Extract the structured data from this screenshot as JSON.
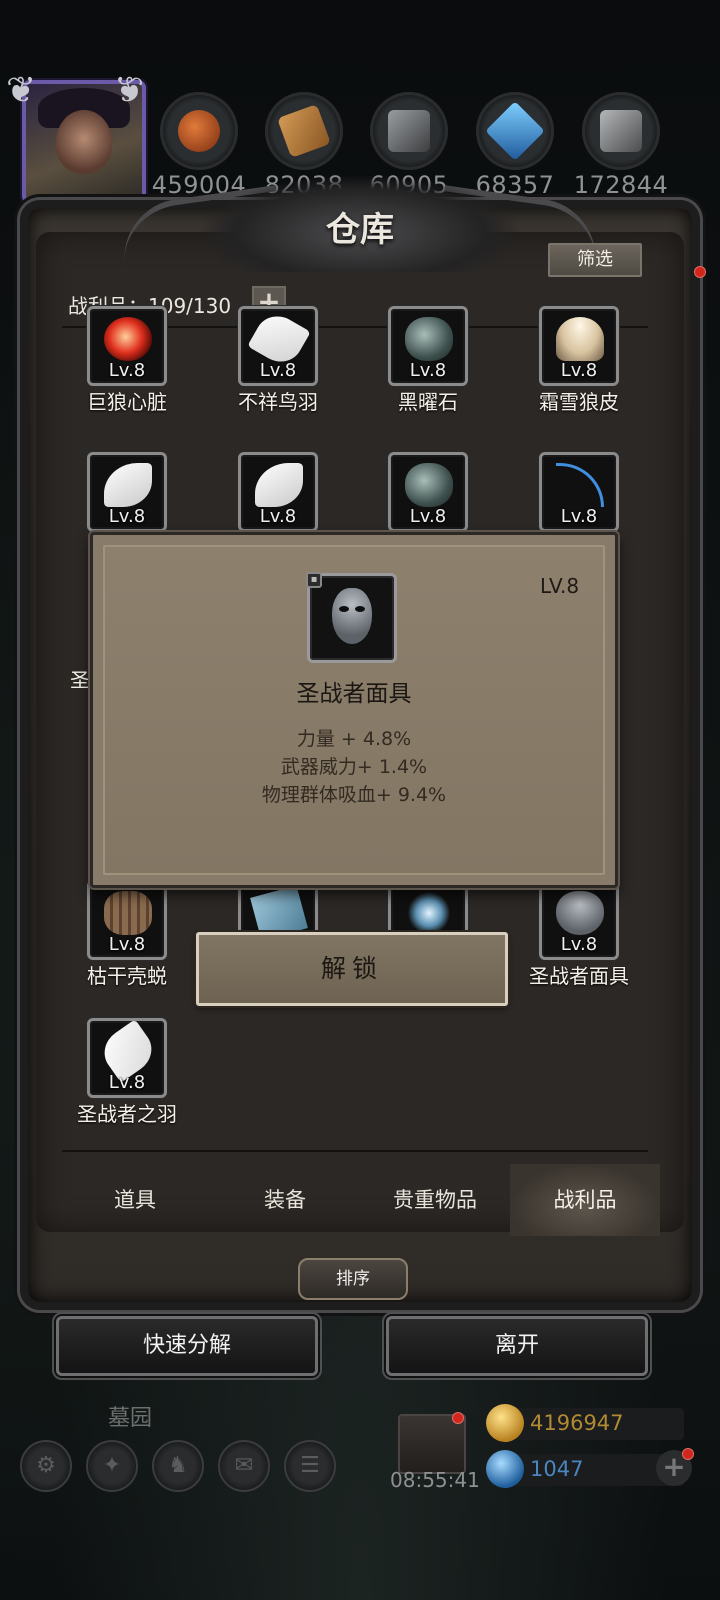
{
  "header": {
    "resources": [
      {
        "icon": "meat-icon",
        "value": "459004",
        "color": "#b35a2a"
      },
      {
        "icon": "wood-icon",
        "value": "82038",
        "color": "#b2793b"
      },
      {
        "icon": "iron-icon",
        "value": "60905",
        "color": "#6f7275"
      },
      {
        "icon": "crystal-icon",
        "value": "68357",
        "color": "#3c8fd0"
      },
      {
        "icon": "steel-icon",
        "value": "172844",
        "color": "#7a7c7e"
      }
    ]
  },
  "warehouse": {
    "title": "仓库",
    "filter_label": "筛选",
    "count_label": "战利品：109/130",
    "items_row1": [
      {
        "lv": "Lv.8",
        "name": "巨狼心脏",
        "icon": "heart-icon"
      },
      {
        "lv": "Lv.8",
        "name": "不祥鸟羽",
        "icon": "feather-icon"
      },
      {
        "lv": "Lv.8",
        "name": "黑曜石",
        "icon": "obsidian-icon"
      },
      {
        "lv": "Lv.8",
        "name": "霜雪狼皮",
        "icon": "wolf-pelt-icon"
      }
    ],
    "items_row2": [
      {
        "lv": "Lv.8",
        "icon": "wing-icon"
      },
      {
        "lv": "Lv.8",
        "icon": "wing-icon"
      },
      {
        "lv": "Lv.8",
        "icon": "obsidian-icon"
      },
      {
        "lv": "Lv.8",
        "icon": "scythe-icon"
      }
    ],
    "partial_left_name": "圣",
    "items_row4": [
      {
        "lv": "Lv.8",
        "name": "枯干壳蜕",
        "icon": "husk-icon"
      },
      {
        "lv": "",
        "name": "",
        "icon": "book-icon"
      },
      {
        "lv": "",
        "name": "",
        "icon": "emblem-icon"
      },
      {
        "lv": "Lv.8",
        "name": "圣战者面具",
        "icon": "mask-icon"
      }
    ],
    "items_row5": [
      {
        "lv": "Lv.8",
        "name": "圣战者之羽",
        "icon": "white-feather-icon"
      }
    ],
    "tabs": [
      {
        "label": "道具"
      },
      {
        "label": "装备"
      },
      {
        "label": "贵重物品"
      },
      {
        "label": "战利品",
        "active": true
      }
    ],
    "sort_label": "排序"
  },
  "popup": {
    "level": "LV.8",
    "item_name": "圣战者面具",
    "stats": [
      "力量 + 4.8%",
      "武器威力+ 1.4%",
      "物理群体吸血+ 9.4%"
    ],
    "unlock_label": "解锁"
  },
  "footer": {
    "quick_decompose_label": "快速分解",
    "leave_label": "离开",
    "location": "墓园",
    "timer": "08:55:41",
    "gold": "4196947",
    "gems": "1047",
    "gold_color": "#c9982e",
    "gem_color": "#3b82c4"
  }
}
